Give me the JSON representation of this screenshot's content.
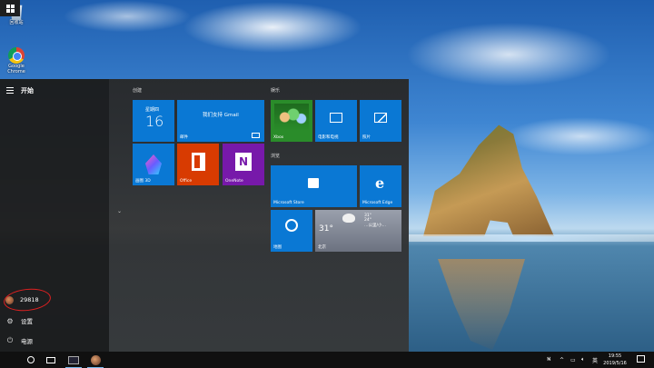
{
  "desktop": {
    "icons": [
      {
        "label": "回收站",
        "icon": "recycle-bin-icon"
      },
      {
        "label": "Google Chrome",
        "icon": "chrome-icon"
      }
    ]
  },
  "start_menu": {
    "title": "开始",
    "left_items": [
      {
        "label": "29818",
        "icon": "user-avatar"
      },
      {
        "label": "设置",
        "icon": "gear-icon"
      },
      {
        "label": "电源",
        "icon": "power-icon"
      }
    ],
    "groups": {
      "create": "创建",
      "entertainment": "娱乐",
      "browse": "浏览"
    },
    "tiles": {
      "calendar": {
        "weekday": "星期四",
        "day": "16"
      },
      "mail": {
        "text": "我们支持 Gmail",
        "label": "邮件"
      },
      "paint3d": {
        "label": "画图 3D"
      },
      "office": {
        "label": "Office"
      },
      "onenote": {
        "label": "OneNote"
      },
      "xbox": {
        "label": "Xbox"
      },
      "movies": {
        "label": "电影和电视"
      },
      "photos": {
        "label": "照片"
      },
      "store": {
        "label": "Microsoft Store"
      },
      "edge": {
        "label": "Microsoft Edge"
      },
      "maps": {
        "label": "地图"
      },
      "weather": {
        "temp": "31°",
        "city": "北京",
        "hi": "31°",
        "lo": "24°",
        "desc": "…公里/小…"
      }
    }
  },
  "taskbar": {
    "time": "19:55",
    "date": "2019/5/16",
    "tray_lang": "英"
  }
}
